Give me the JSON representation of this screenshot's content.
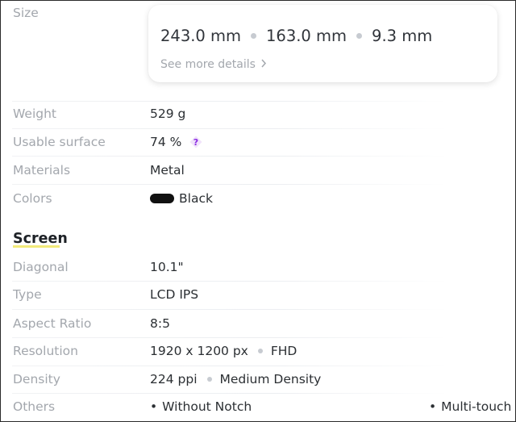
{
  "size": {
    "label": "Size",
    "dims": [
      "243.0 mm",
      "163.0 mm",
      "9.3 mm"
    ],
    "see_more": "See more details"
  },
  "general": [
    {
      "label": "Weight",
      "value": "529 g"
    },
    {
      "label": "Usable surface",
      "value": "74 %",
      "help_icon": "question-mark-icon"
    },
    {
      "label": "Materials",
      "value": "Metal"
    },
    {
      "label": "Colors",
      "value": "Black",
      "swatch_color": "#111111"
    }
  ],
  "screen": {
    "title": "Screen",
    "underline_color": "#f2ea7a",
    "diagonal": {
      "label": "Diagonal",
      "value": "10.1\""
    },
    "type": {
      "label": "Type",
      "value": "LCD IPS"
    },
    "aspect_ratio": {
      "label": "Aspect Ratio",
      "value": "8:5"
    },
    "resolution": {
      "label": "Resolution",
      "value": "1920 x 1200 px",
      "tag": "FHD"
    },
    "density": {
      "label": "Density",
      "value": "224 ppi",
      "tag": "Medium Density"
    },
    "others": {
      "label": "Others",
      "features": [
        "Without Notch",
        "Multi-touch"
      ]
    }
  }
}
